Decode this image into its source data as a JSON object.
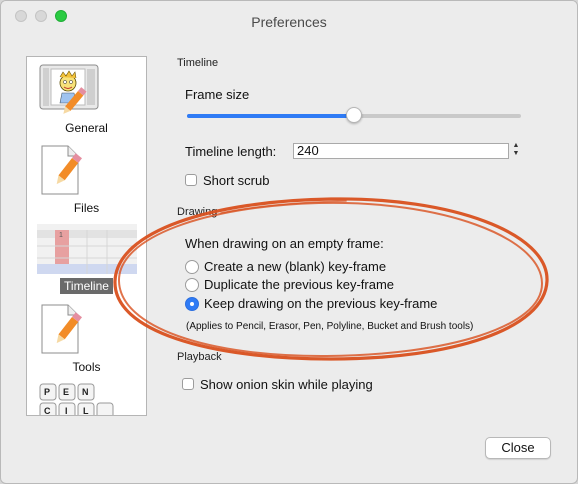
{
  "window": {
    "title": "Preferences"
  },
  "sidebar": {
    "items": [
      {
        "label": "General",
        "icon": "general-icon"
      },
      {
        "label": "Files",
        "icon": "files-icon"
      },
      {
        "label": "Timeline",
        "icon": "timeline-icon",
        "selected": true
      },
      {
        "label": "Tools",
        "icon": "tools-icon"
      },
      {
        "label": "",
        "icon": "shortcuts-keys-icon",
        "keys": [
          "P",
          "E",
          "N",
          "C",
          "I",
          "L"
        ]
      }
    ]
  },
  "timeline": {
    "section_title": "Timeline",
    "frame_size_label": "Frame size",
    "frame_size_fraction": 0.5,
    "timeline_length_label": "Timeline length:",
    "timeline_length_value": "240",
    "short_scrub_label": "Short scrub",
    "short_scrub_checked": false
  },
  "drawing": {
    "section_title": "Drawing",
    "question": "When drawing on an empty frame:",
    "options": [
      {
        "label": "Create a new (blank) key-frame",
        "checked": false
      },
      {
        "label": "Duplicate the previous key-frame",
        "checked": false
      },
      {
        "label": "Keep drawing on the previous key-frame",
        "checked": true
      }
    ],
    "note": "(Applies to Pencil, Erasor, Pen, Polyline, Bucket and Brush tools)"
  },
  "playback": {
    "section_title": "Playback",
    "onion_skin_label": "Show onion skin while playing",
    "onion_skin_checked": false
  },
  "buttons": {
    "close_label": "Close"
  },
  "colors": {
    "accent": "#2f7bf5",
    "annotation": "#d9501e",
    "zoom_button": "#2acb42"
  }
}
